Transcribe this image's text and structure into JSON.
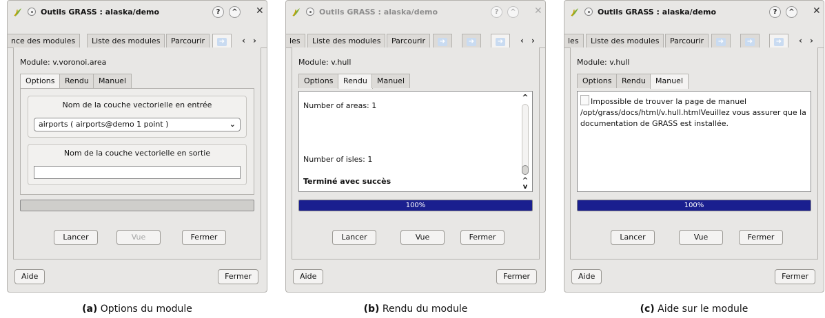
{
  "panels": [
    {
      "window_title": "Outils GRASS : alaska/demo",
      "tabs": [
        "nce des modules",
        "Liste des modules",
        "Parcourir"
      ],
      "module_label": "Module: v.voronoi.area",
      "subtabs": [
        "Options",
        "Rendu",
        "Manuel"
      ],
      "active_subtab": "Options",
      "input_layer_title": "Nom de la couche vectorielle en entrée",
      "input_layer_value": "airports ( airports@demo 1 point )",
      "output_layer_title": "Nom de la couche vectorielle en sortie",
      "output_layer_value": "",
      "progress": 0,
      "buttons": {
        "run": "Lancer",
        "view": "Vue",
        "close": "Fermer"
      },
      "view_enabled": false,
      "help": "Aide",
      "close_bottom": "Fermer",
      "caption_label": "(a)",
      "caption_text": " Options du module"
    },
    {
      "window_title": "Outils GRASS : alaska/demo",
      "tabs": [
        "les",
        "Liste des modules",
        "Parcourir"
      ],
      "module_label": "Module: v.hull",
      "subtabs": [
        "Options",
        "Rendu",
        "Manuel"
      ],
      "active_subtab": "Rendu",
      "output_lines": [
        "Number of areas: 1",
        "Number of isles: 1",
        "Terminé avec succès"
      ],
      "progress": 1,
      "progress_text": "100%",
      "buttons": {
        "run": "Lancer",
        "view": "Vue",
        "close": "Fermer"
      },
      "help": "Aide",
      "close_bottom": "Fermer",
      "caption_label": "(b)",
      "caption_text": " Rendu du module"
    },
    {
      "window_title": "Outils GRASS : alaska/demo",
      "tabs": [
        "les",
        "Liste des modules",
        "Parcourir"
      ],
      "module_label": "Module: v.hull",
      "subtabs": [
        "Options",
        "Rendu",
        "Manuel"
      ],
      "active_subtab": "Manuel",
      "manual_text": "Impossible de trouver la page de manuel /opt/grass/docs/html/v.hull.htmlVeuillez vous assurer que la documentation de GRASS est installée.",
      "progress": 1,
      "progress_text": "100%",
      "buttons": {
        "run": "Lancer",
        "view": "Vue",
        "close": "Fermer"
      },
      "help": "Aide",
      "close_bottom": "Fermer",
      "caption_label": "(c)",
      "caption_text": " Aide sur le module"
    }
  ],
  "icons": {
    "app": "grass-leaf-icon",
    "pin": "pin-icon",
    "help": "help-icon",
    "minimize": "minimize-icon",
    "close": "close-icon",
    "tab_arrow": "arrow-right-icon"
  },
  "colors": {
    "progress_fill": "#1a1f8f",
    "window_bg": "#e8e7e5"
  }
}
